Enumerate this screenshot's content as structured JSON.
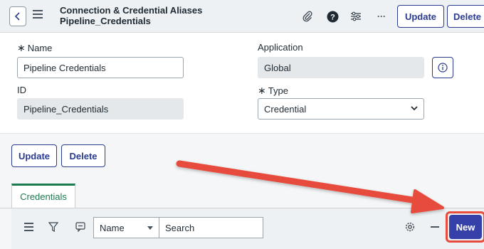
{
  "header": {
    "title_line1": "Connection & Credential Aliases",
    "title_line2": "Pipeline_Credentials",
    "update_label": "Update",
    "delete_label": "Delete",
    "more_label": "···"
  },
  "form": {
    "name_label": "Name",
    "name_value": "Pipeline Credentials",
    "application_label": "Application",
    "application_value": "Global",
    "id_label": "ID",
    "id_value": "Pipeline_Credentials",
    "type_label": "Type",
    "type_value": "Credential",
    "required_mark": "∗",
    "update_label": "Update",
    "delete_label": "Delete"
  },
  "related": {
    "tab_label": "Credentials",
    "filter_field": "Name",
    "search_placeholder": "Search",
    "new_label": "New"
  },
  "colors": {
    "accent": "#2a3b8f",
    "tab_active": "#1b7a4e",
    "highlight": "#e74c3c",
    "primary_btn": "#3541a8"
  }
}
